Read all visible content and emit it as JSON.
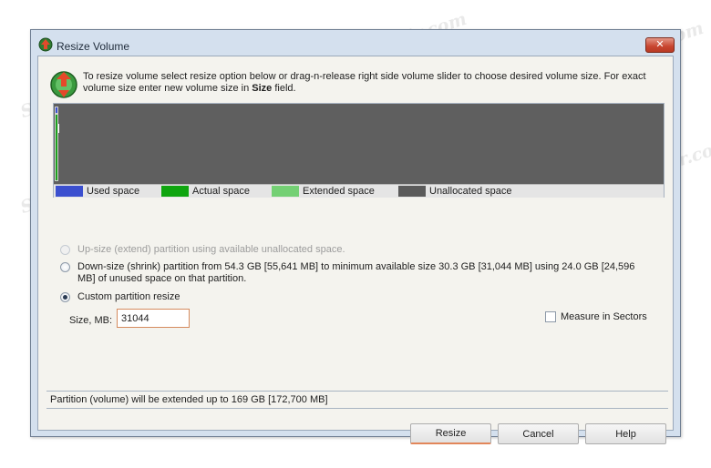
{
  "window": {
    "title": "Resize Volume",
    "close_label": "✕"
  },
  "instruction": {
    "part1": "To resize volume select resize option below or drag-n-release right side volume slider to choose desired volume size. For exact volume size enter new volume size in ",
    "bold": "Size",
    "part2": " field."
  },
  "volume_bar": {
    "colors": {
      "used": "#3b4fcf",
      "actual": "#1ba11b",
      "extended": "#74d074",
      "unallocated": "#5f5f5f"
    }
  },
  "legend": [
    {
      "label": "Used space",
      "color": "#3b4fcf"
    },
    {
      "label": "Actual space",
      "color": "#0fa50f"
    },
    {
      "label": "Extended space",
      "color": "#74d074"
    },
    {
      "label": "Unallocated space",
      "color": "#5a5a5a"
    }
  ],
  "options": {
    "upsize": {
      "label": "Up-size (extend) partition using available unallocated space.",
      "state": "disabled"
    },
    "downsize": {
      "label": "Down-size (shrink) partition from 54.3 GB [55,641 MB] to minimum available size 30.3 GB [31,044 MB] using 24.0 GB [24,596 MB] of unused space on that partition.",
      "state": "unchecked"
    },
    "custom": {
      "label": "Custom partition resize",
      "state": "checked"
    }
  },
  "size": {
    "label": "Size, MB:",
    "value": "31044"
  },
  "measure_sectors": {
    "label": "Measure in Sectors",
    "checked": false
  },
  "status": "Partition (volume) will be extended up to 169 GB [172,700 MB]",
  "buttons": {
    "resize": "Resize",
    "cancel": "Cancel",
    "help": "Help"
  },
  "watermark": "Sovingperepair.com"
}
